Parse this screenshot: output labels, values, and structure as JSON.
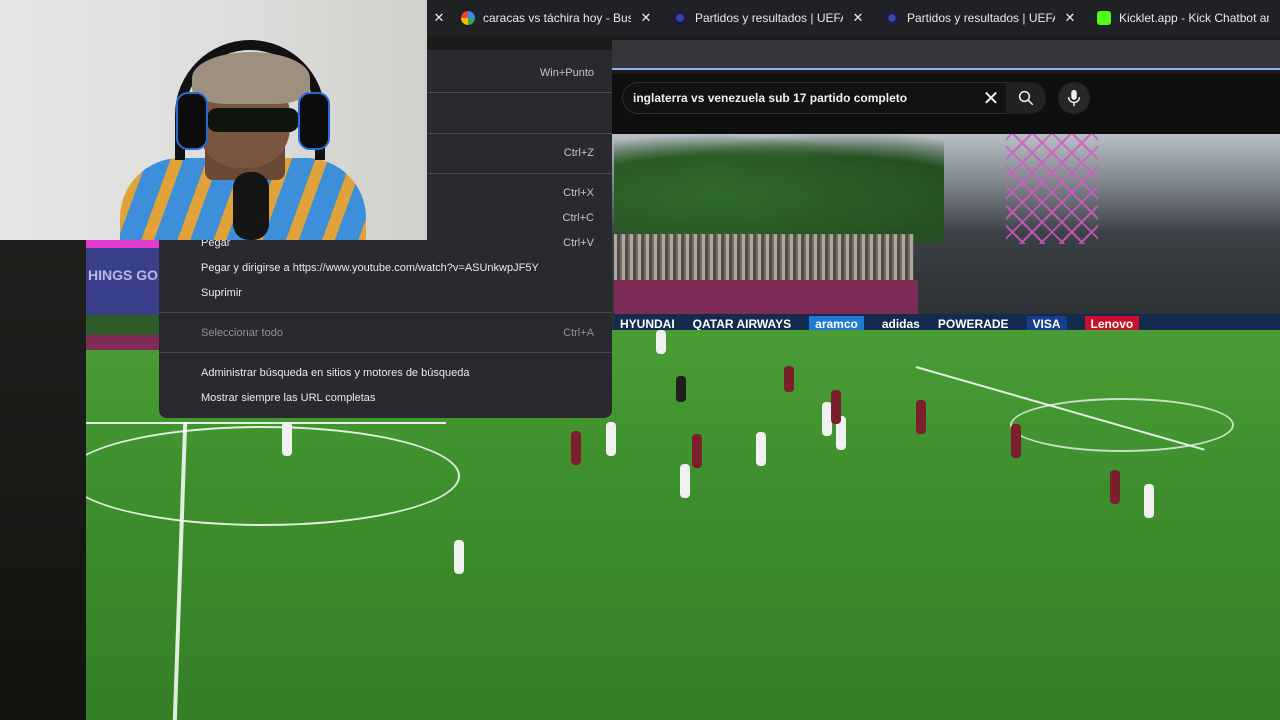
{
  "tabs": [
    {
      "title": "caracas vs táchira hoy - Buscar con Google",
      "favicon": "google-icon",
      "close": "✕"
    },
    {
      "title": "Partidos y resultados | UEFA Champions League",
      "favicon": "uefa-icon",
      "close": "✕"
    },
    {
      "title": "Partidos y resultados | UEFA Champions League",
      "favicon": "uefa-icon",
      "close": "✕"
    },
    {
      "title": "Kicklet.app - Kick Chatbot and",
      "favicon": "kicklet-icon",
      "close": ""
    }
  ],
  "first_tab_close": "✕",
  "youtube": {
    "search_query": "inglaterra vs venezuela sub 17 partido completo",
    "clear_icon": "✕"
  },
  "context_menu": {
    "items": [
      {
        "label": "",
        "shortcut": "Win+Punto"
      },
      {
        "label": "",
        "shortcut": "Ctrl+Z"
      },
      {
        "label": "",
        "shortcut": "Ctrl+X"
      },
      {
        "label": "",
        "shortcut": "Ctrl+C"
      },
      {
        "label": "Pegar",
        "shortcut": "Ctrl+V"
      },
      {
        "label": "Pegar y dirigirse a https://www.youtube.com/watch?v=ASUnkwpJF5Y",
        "shortcut": ""
      },
      {
        "label": "Suprimir",
        "shortcut": ""
      },
      {
        "label": "Seleccionar todo",
        "shortcut": "Ctrl+A",
        "disabled": true
      },
      {
        "label": "Administrar búsqueda en sitios y motores de búsqueda",
        "shortcut": ""
      },
      {
        "label": "Mostrar siempre las URL completas",
        "shortcut": ""
      }
    ]
  },
  "video": {
    "ads": [
      "HYUNDAI",
      "QATAR AIRWAYS",
      "aramco",
      "adidas",
      "VISA",
      "POWERADE",
      "Lenovo"
    ],
    "badge_text": "HINGS GOAT"
  },
  "colors": {
    "accent": "#8ab4f8",
    "menu_bg": "#292a2d",
    "tab_bg": "#202124"
  }
}
